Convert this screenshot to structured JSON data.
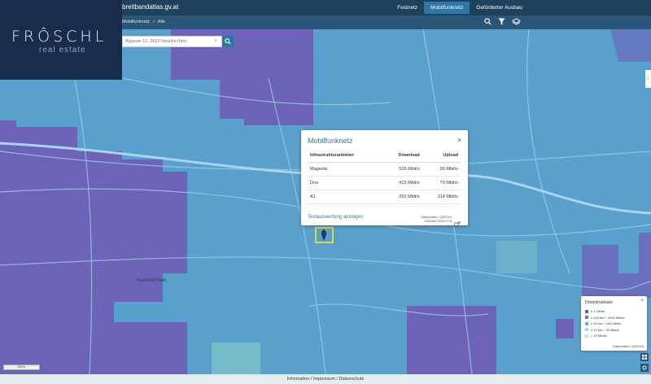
{
  "site": {
    "title": "breitbandatlas.gv.at"
  },
  "nav": {
    "items": [
      "Festnetz",
      "Mobilfunknetz",
      "Geförderter Ausbau"
    ],
    "active": "Mobilfunknetz"
  },
  "breadcrumb": [
    "Mobilfunknetz",
    "›",
    "Alle"
  ],
  "logo": {
    "name": "FRÔSCHL",
    "sub": "real estate"
  },
  "search": {
    "value": "Aigasse 12, 2620 Neunkirchen",
    "clear": "×"
  },
  "popup": {
    "title": "Mobilfunknetz",
    "close": "×",
    "headers": {
      "provider": "Infrastrukturanbieter",
      "download": "Download",
      "upload": "Upload"
    },
    "rows": [
      {
        "provider": "Magenta",
        "download": "526 Mbit/s",
        "upload": "90 Mbit/s"
      },
      {
        "provider": "Drei",
        "download": "423 Mbit/s",
        "upload": "70 Mbit/s"
      },
      {
        "provider": "A1",
        "download": "253 Mbit/s",
        "upload": "114 Mbit/s"
      }
    ],
    "link": "Testauswertung anzeigen",
    "stamp_line1": "Datenstand: Q3/2024",
    "stamp_line2": "100mN2751E4776"
  },
  "legend": {
    "title": "Downloadrate",
    "close": "×",
    "items": [
      {
        "label": "≥ 1 Gbit/s",
        "color": "#5a5fb0"
      },
      {
        "label": "≥ 100 bis < 1000 Mbit/s",
        "color": "#5b7fc4"
      },
      {
        "label": "≥ 30 bis < 100 Mbit/s",
        "color": "#63b3d4"
      },
      {
        "label": "≥ 10 bis < 30 Mbit/s",
        "color": "#a9d9cf"
      },
      {
        "label": "< 10 Mbit/s",
        "color": "#fffbd6"
      }
    ],
    "stamp": "Datenstand: Q3/2024"
  },
  "map": {
    "city_label": "Neunkirchen",
    "scale": "200 m",
    "side_toggle": "‹"
  },
  "footer": {
    "text": "Information / Impressum / Datenschutz"
  },
  "colors": {
    "purple": "#6d63b8",
    "blue": "#5aa0cc",
    "teal": "#7fc4c8",
    "marker": "#f4f02a",
    "header": "#20415c",
    "accent": "#2f77a6"
  }
}
